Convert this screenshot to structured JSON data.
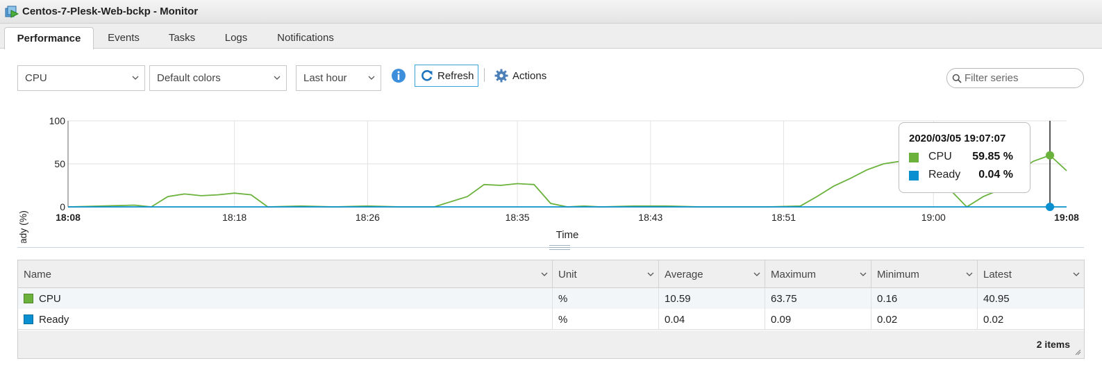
{
  "window": {
    "title": "Centos-7-Plesk-Web-bckp - Monitor",
    "icon": "vm-icon"
  },
  "tabs": [
    {
      "label": "Performance",
      "active": true
    },
    {
      "label": "Events",
      "active": false
    },
    {
      "label": "Tasks",
      "active": false
    },
    {
      "label": "Logs",
      "active": false
    },
    {
      "label": "Notifications",
      "active": false
    }
  ],
  "toolbar": {
    "metric_select": "CPU",
    "color_select": "Default colors",
    "timespan_select": "Last hour",
    "refresh_label": "Refresh",
    "actions_label": "Actions",
    "filter_placeholder": "Filter series"
  },
  "colors": {
    "cpu": "#6ab23c",
    "ready": "#0a8fd1",
    "accent": "#3aa5dc"
  },
  "tooltip": {
    "time": "2020/03/05 19:07:07",
    "rows": [
      {
        "name": "CPU",
        "value": "59.85 %"
      },
      {
        "name": "Ready",
        "value": "0.04 %"
      }
    ]
  },
  "chart_data": {
    "type": "line",
    "xlabel": "Time",
    "ylabel": "Consumed host CPU / ready (%)",
    "ylim": [
      0,
      100
    ],
    "yticks": [
      0,
      50,
      100
    ],
    "xlim": [
      "18:08",
      "19:08"
    ],
    "xticks": [
      "18:08",
      "18:18",
      "18:26",
      "18:35",
      "18:43",
      "18:51",
      "19:00",
      "19:08"
    ],
    "grid": true,
    "series": [
      {
        "name": "CPU",
        "color": "#6ab23c",
        "x": [
          "18:08",
          "18:10",
          "18:12",
          "18:13",
          "18:14",
          "18:15",
          "18:16",
          "18:17",
          "18:18",
          "18:19",
          "18:20",
          "18:22",
          "18:24",
          "18:26",
          "18:28",
          "18:30",
          "18:32",
          "18:33",
          "18:34",
          "18:35",
          "18:36",
          "18:37",
          "18:38",
          "18:39",
          "18:40",
          "18:42",
          "18:44",
          "18:46",
          "18:48",
          "18:50",
          "18:52",
          "18:53",
          "18:54",
          "18:55",
          "18:56",
          "18:57",
          "18:58",
          "18:59",
          "19:00",
          "19:01",
          "19:02",
          "19:03",
          "19:04",
          "19:05",
          "19:06",
          "19:07",
          "19:08"
        ],
        "y": [
          0,
          1,
          2,
          0,
          12,
          15,
          13,
          14,
          16,
          14,
          0,
          1,
          0,
          1,
          0,
          0,
          12,
          26,
          25,
          27,
          26,
          4,
          0,
          1,
          0,
          1,
          1,
          0,
          0,
          0,
          1,
          12,
          24,
          33,
          43,
          50,
          53,
          49,
          30,
          20,
          0,
          12,
          20,
          40,
          53,
          60,
          42
        ]
      },
      {
        "name": "Ready",
        "color": "#0a8fd1",
        "x": [
          "18:08",
          "19:08"
        ],
        "y": [
          0.04,
          0.04
        ]
      }
    ]
  },
  "table": {
    "columns": [
      "Name",
      "Unit",
      "Average",
      "Maximum",
      "Minimum",
      "Latest"
    ],
    "rows": [
      {
        "name": "CPU",
        "unit": "%",
        "average": "10.59",
        "maximum": "63.75",
        "minimum": "0.16",
        "latest": "40.95"
      },
      {
        "name": "Ready",
        "unit": "%",
        "average": "0.04",
        "maximum": "0.09",
        "minimum": "0.02",
        "latest": "0.02"
      }
    ],
    "count_label": "2 items"
  }
}
